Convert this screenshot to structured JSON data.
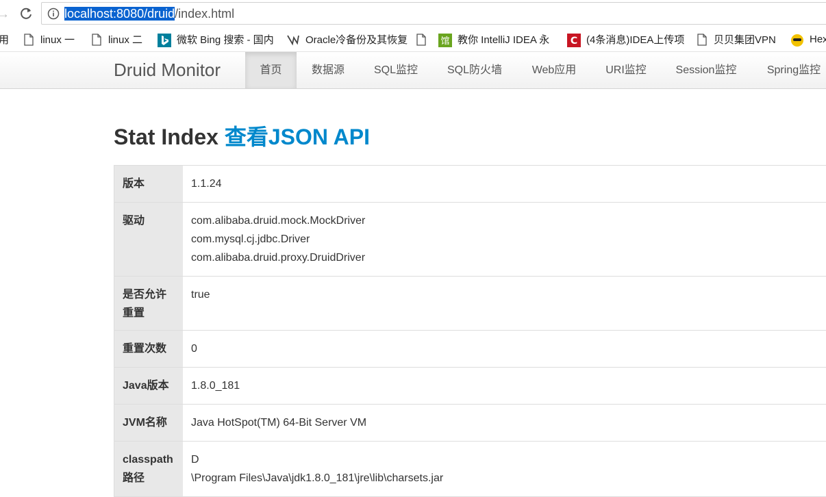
{
  "browser": {
    "url_highlight": "localhost:8080/druid",
    "url_rest": "/index.html",
    "bookmarks": [
      {
        "label": "用",
        "icon": "none"
      },
      {
        "label": "linux 一",
        "icon": "page-icon"
      },
      {
        "label": "linux 二",
        "icon": "page-icon"
      },
      {
        "label": "微软 Bing 搜索 - 国内",
        "icon": "bing-icon"
      },
      {
        "label": "Oracle冷备份及其恢复",
        "icon": "oracle-icon"
      },
      {
        "label": "",
        "icon": "page-icon"
      },
      {
        "label": "教你 IntelliJ IDEA 永",
        "icon": "green-badge-icon"
      },
      {
        "label": "(4条消息)IDEA上传项",
        "icon": "csdn-icon"
      },
      {
        "label": "贝贝集团VPN",
        "icon": "page-icon"
      },
      {
        "label": "Hex",
        "icon": "hex-icon"
      }
    ]
  },
  "navbar": {
    "brand": "Druid Monitor",
    "items": [
      "首页",
      "数据源",
      "SQL监控",
      "SQL防火墙",
      "Web应用",
      "URI监控",
      "Session监控",
      "Spring监控"
    ],
    "active_index": 0
  },
  "content": {
    "title": "Stat Index",
    "json_link": "查看JSON API",
    "rows": [
      {
        "key": "版本",
        "values": [
          "1.1.24"
        ]
      },
      {
        "key": "驱动",
        "values": [
          "com.alibaba.druid.mock.MockDriver",
          "com.mysql.cj.jdbc.Driver",
          "com.alibaba.druid.proxy.DruidDriver"
        ]
      },
      {
        "key": "是否允许重置",
        "values": [
          "true"
        ]
      },
      {
        "key": "重置次数",
        "values": [
          "0"
        ]
      },
      {
        "key": "Java版本",
        "values": [
          "1.8.0_181"
        ]
      },
      {
        "key": "JVM名称",
        "values": [
          "Java HotSpot(TM) 64-Bit Server VM"
        ]
      },
      {
        "key": "classpath路径",
        "values": [
          "D",
          "\\Program Files\\Java\\jdk1.8.0_181\\jre\\lib\\charsets.jar"
        ]
      }
    ]
  },
  "colors": {
    "link": "#0088cc",
    "url_selection": "#0a63d0",
    "key_cell_bg": "#e8e8e8"
  }
}
